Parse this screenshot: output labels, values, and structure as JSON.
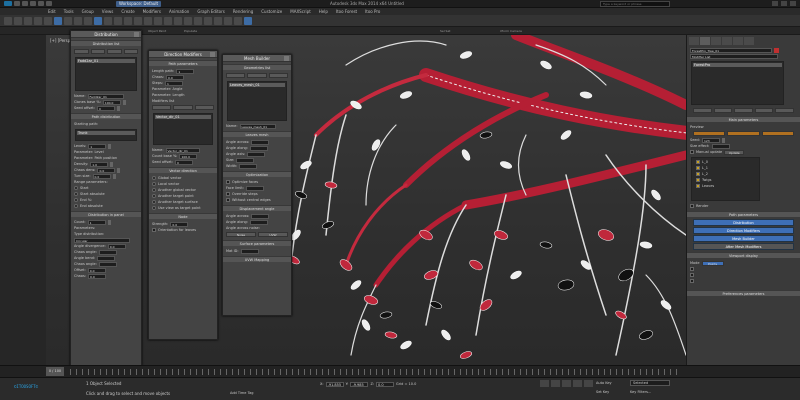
{
  "titlebar": {
    "workspace": "Workspace: Default",
    "app_title": "Autodesk 3ds Max 2014 x64   Untitled",
    "search_placeholder": "Type a keyword or phrase"
  },
  "menubar": {
    "items": [
      "Edit",
      "Tools",
      "Group",
      "Views",
      "Create",
      "Modifiers",
      "Animation",
      "Graph Editors",
      "Rendering",
      "Customize",
      "MAXScript",
      "Help",
      "Itoo Forest",
      "Itoo Pro"
    ]
  },
  "ribbon": {
    "label1": "Object Paint",
    "label2": "Populate",
    "label3": "Sel Set",
    "label4": "Xform Camera"
  },
  "viewport": {
    "label": "[+] [Perspective] [Realistic]"
  },
  "panel_distribution": {
    "title": "Distribution",
    "section1": "Distribution list",
    "list_item": "Fadd2ar_01",
    "name_label": "Name:",
    "name_value": "Fadd2ar_01",
    "clones_label": "Clones base %:",
    "clones_value": "100.0",
    "seed_label": "Seed offset:",
    "seed_value": "0",
    "section2": "Path distribution",
    "start_label": "Starting path:",
    "trunk_label": "Trunk",
    "levels_label": "Levels:",
    "levels_value": "1",
    "param_level": "Parameter: Level",
    "param_path": "Parameter: Path position",
    "density_label": "Density:",
    "density_value": "1.0",
    "chaos_label": "Chaos dens:",
    "chaos_value": "0.0",
    "turn_label": "Turn size:",
    "turn_value": "0.0",
    "range_label": "Range parameters:",
    "start_r": "Start",
    "start_abs": "Start absolute",
    "end_r": "End %:",
    "end_abs": "End absolute",
    "section3": "Distribution in panel",
    "count_label": "Count:",
    "count_value": "1",
    "params_label": "Parameters:",
    "type_label": "Type distribution:",
    "type_value": "Circular",
    "angle_div": "Angle divergence:",
    "angle_val": "0.0",
    "chaos_angle": "Chaos angle:",
    "angle_bend": "Angle bend:",
    "angle_chaos": "Chaos angle:",
    "offset_label": "Offset:",
    "offset_value": "0.0",
    "chaos2_label": "Chaos:",
    "chaos2_value": "0.0"
  },
  "panel_direction": {
    "title": "Direction Modifiers",
    "section1": "Path parameters",
    "length_label": "Length path:",
    "length_value": "1",
    "chaos_label": "Chaos:",
    "chaos_value": "0.0",
    "steps_label": "Steps:",
    "steps_value": "1",
    "param_angle": "Parameter: Angle",
    "param_length": "Parameter: Length",
    "list_label": "Modifiers list",
    "list_item": "Vector_dir_01",
    "name_label": "Name:",
    "name_value": "Vector_dir_01",
    "count_label": "Count base %:",
    "count_value": "100.0",
    "seed_label": "Seed offset:",
    "seed_value": "0",
    "section2": "Vector direction",
    "opt1": "Global vector",
    "opt2": "Local vector",
    "opt3": "Another global vector",
    "opt4": "Another target point",
    "opt5": "Another target surface",
    "opt6": "Use view as target point",
    "section3": "Node",
    "strength_label": "Strength:",
    "strength_value": "0.0",
    "attenuation_label": "Orientation for leaves"
  },
  "panel_mesh": {
    "title": "Mesh Builder",
    "section1": "Geometries list",
    "list_item": "Leaves_mesh_01",
    "name_label": "Name:",
    "name_value": "Leaves_mesh_01",
    "section2": "Leaves mesh",
    "angle_x": "Angle across:",
    "angle_y": "Angle along:",
    "angle_z": "Angle axis:",
    "size_label": "Size:",
    "width_label": "Width:",
    "section3": "Optimization",
    "opt1": "Optimize faces",
    "opt2": "Face limit:",
    "opt3": "Override steps",
    "opt4": "Without central edges",
    "section4": "Displacement angle",
    "disp1": "Angle across:",
    "disp2": "Angle along:",
    "disp3": "Angle across noise:",
    "noise_label": "Noise",
    "uvw_label": "UVW",
    "section5": "Surface parameters",
    "mat_label": "Mat ID:",
    "section6": "UVW Mapping"
  },
  "command_panel": {
    "object_name": "ForestPro_Tree_01",
    "modifier_list": "Modifier List",
    "stack_item": "ForestPro",
    "section_main": "Main parameters",
    "preview_label": "Preview",
    "seed_label": "Seed:",
    "seed_value": "123",
    "size_label": "Size effect:",
    "manual_label": "Manual update",
    "update_btn": "Update",
    "tree_items": [
      "L_0",
      "L_1",
      "L_2",
      "Twigs",
      "Leaves"
    ],
    "render_label": "Render",
    "section_path": "Path parameters",
    "btn1": "Distribution",
    "btn2": "Direction Modifiers",
    "btn3": "Mesh Builder",
    "btn4": "After Mesh Modifiers",
    "section_display": "Viewport display",
    "disp_mode": "Mode",
    "disp_value": "Points",
    "section_pref": "Preferences parameters"
  },
  "timeline": {
    "frame": "0 / 100"
  },
  "status": {
    "logo": "©ITOOSOFT©",
    "sel": "1 Object Selected",
    "hint": "Click and drag to select and move objects",
    "x_label": "X:",
    "x_value": "-91.855",
    "y_label": "Y:",
    "y_value": "-9.985",
    "z_label": "Z:",
    "z_value": "0.0",
    "grid": "Grid = 10.0",
    "autokey": "Auto Key",
    "selected": "Selected",
    "setkey": "Set Key",
    "keyfilters": "Key Filters...",
    "add_time": "Add Time Tag"
  },
  "colors": {
    "accent": "#3e6fb6",
    "branch": "#c0283c",
    "leaf_white": "#e8e8e8",
    "leaf_dark": "#111111"
  }
}
